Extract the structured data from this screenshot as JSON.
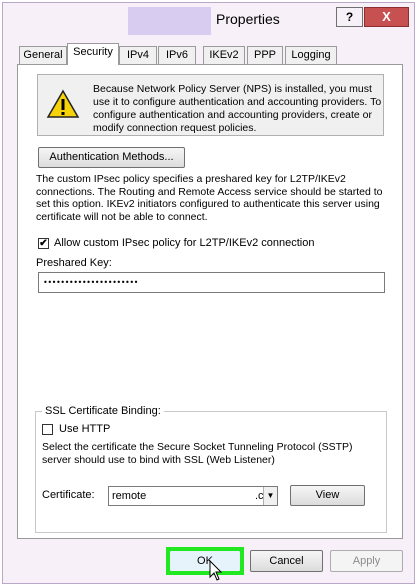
{
  "window": {
    "title": "Properties",
    "help_label": "?",
    "close_label": "X"
  },
  "tabs": [
    {
      "label": "General"
    },
    {
      "label": "Security",
      "active": true
    },
    {
      "label": "IPv4"
    },
    {
      "label": "IPv6"
    },
    {
      "label": "IKEv2"
    },
    {
      "label": "PPP"
    },
    {
      "label": "Logging"
    }
  ],
  "notice": {
    "text": "Because Network Policy Server (NPS) is installed, you must use it to configure authentication and accounting providers. To configure authentication and accounting providers, create or modify connection request policies.",
    "icon": "warning-icon"
  },
  "auth_methods_button": "Authentication Methods...",
  "ipsec_description": "The custom IPsec policy specifies a preshared key for L2TP/IKEv2 connections. The Routing and Remote Access service should be started to set this option. IKEv2 initiators configured to authenticate this server using certificate will not be able to connect.",
  "allow_ipsec": {
    "label": "Allow custom IPsec policy for L2TP/IKEv2 connection",
    "checked": true,
    "check_mark": "✔"
  },
  "preshared_key": {
    "label": "Preshared Key:",
    "value": "••••••••••••••••••••••"
  },
  "ssl_binding": {
    "legend": "SSL Certificate Binding:",
    "use_http_label": "Use HTTP",
    "use_http_checked": false,
    "description": "Select the certificate the Secure Socket Tunneling Protocol (SSTP) server should use to bind with SSL (Web Listener)",
    "certificate_label": "Certificate:",
    "certificate_value": "remote",
    "certificate_suffix": ".c",
    "view_button": "View"
  },
  "footer": {
    "ok": "OK",
    "cancel": "Cancel",
    "apply": "Apply"
  },
  "colors": {
    "highlight_outline": "#22e822",
    "close_button": "#c75050",
    "window_frame": "#f7f0f8"
  }
}
